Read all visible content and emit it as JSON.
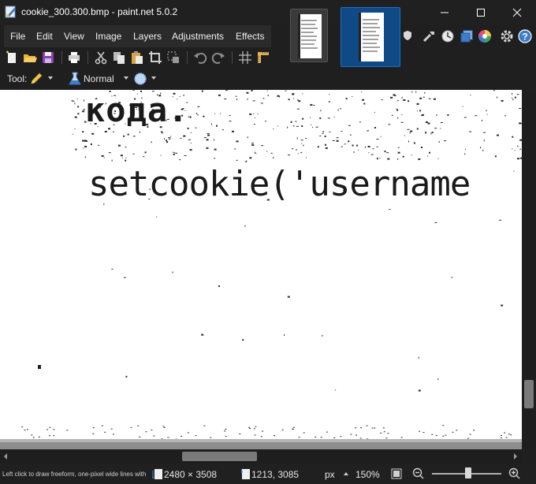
{
  "window": {
    "title": "cookie_300.300.bmp - paint.net 5.0.2"
  },
  "image_tabs": [
    {
      "name": "thumbnail-1",
      "selected": false
    },
    {
      "name": "thumbnail-2",
      "selected": true
    }
  ],
  "menu": {
    "items": [
      {
        "label": "File"
      },
      {
        "label": "Edit"
      },
      {
        "label": "View"
      },
      {
        "label": "Image"
      },
      {
        "label": "Layers"
      },
      {
        "label": "Adjustments"
      },
      {
        "label": "Effects"
      }
    ]
  },
  "right_icons": [
    "settings-shield-icon",
    "tools-icon",
    "history-icon",
    "layers-icon",
    "colors-icon",
    "gear-icon",
    "help-icon"
  ],
  "toolbar": {
    "icons": [
      "new-icon",
      "open-icon",
      "save-icon",
      "print-icon",
      "cut-icon",
      "copy-icon",
      "paste-icon",
      "crop-icon",
      "deselect-icon",
      "undo-icon",
      "redo-icon",
      "grid-icon",
      "ruler-icon"
    ]
  },
  "tool_options": {
    "tool_label": "Tool:",
    "tool_icon": "pencil-icon",
    "blend_mode": "Normal",
    "blend_icon": "flask-icon",
    "alpha_icon": "antialias-icon"
  },
  "canvas": {
    "line1": "кода.",
    "line2": "setcookie('username"
  },
  "status": {
    "hint": "Left click to draw freeform, one-pixel wide lines with t...",
    "image_size": "2480 × 3508",
    "cursor_position": "1213, 3085",
    "units": "px",
    "zoom": "150%",
    "zoom_fraction": 0.5
  },
  "colors": {
    "background": "#1f1f1f",
    "accent": "#1b6fc8",
    "canvas": "#ffffff"
  }
}
